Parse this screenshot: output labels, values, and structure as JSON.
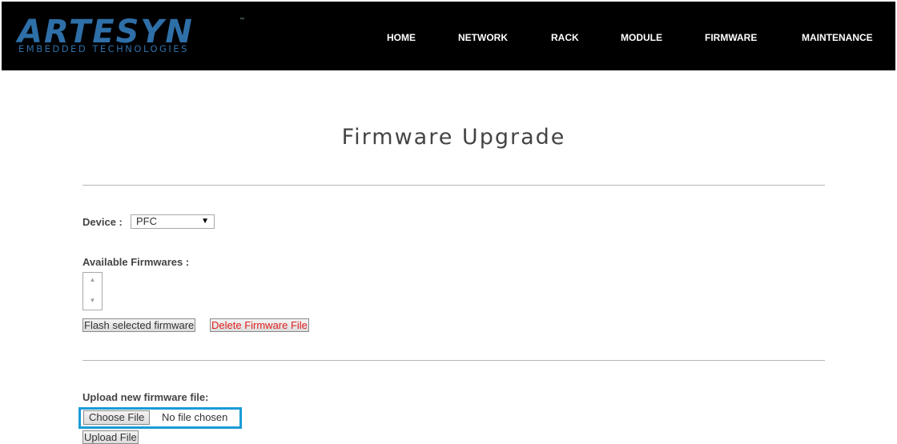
{
  "brand": {
    "name": "ARTESYN",
    "tagline": "EMBEDDED TECHNOLOGIES",
    "trademark": "™",
    "color": "#2e6fa8"
  },
  "nav": {
    "items": [
      "HOME",
      "NETWORK",
      "RACK",
      "MODULE",
      "FIRMWARE",
      "MAINTENANCE"
    ]
  },
  "page": {
    "title": "Firmware Upgrade"
  },
  "device": {
    "label": "Device :",
    "selected": "PFC"
  },
  "firmwares": {
    "label": "Available Firmwares :",
    "items": [],
    "flash_button": "Flash selected firmware",
    "delete_button": "Delete Firmware File"
  },
  "upload": {
    "label": "Upload new firmware file:",
    "choose_button": "Choose File",
    "no_file_text": "No file chosen",
    "upload_button": "Upload File",
    "highlight_color": "#1a9bd7"
  }
}
